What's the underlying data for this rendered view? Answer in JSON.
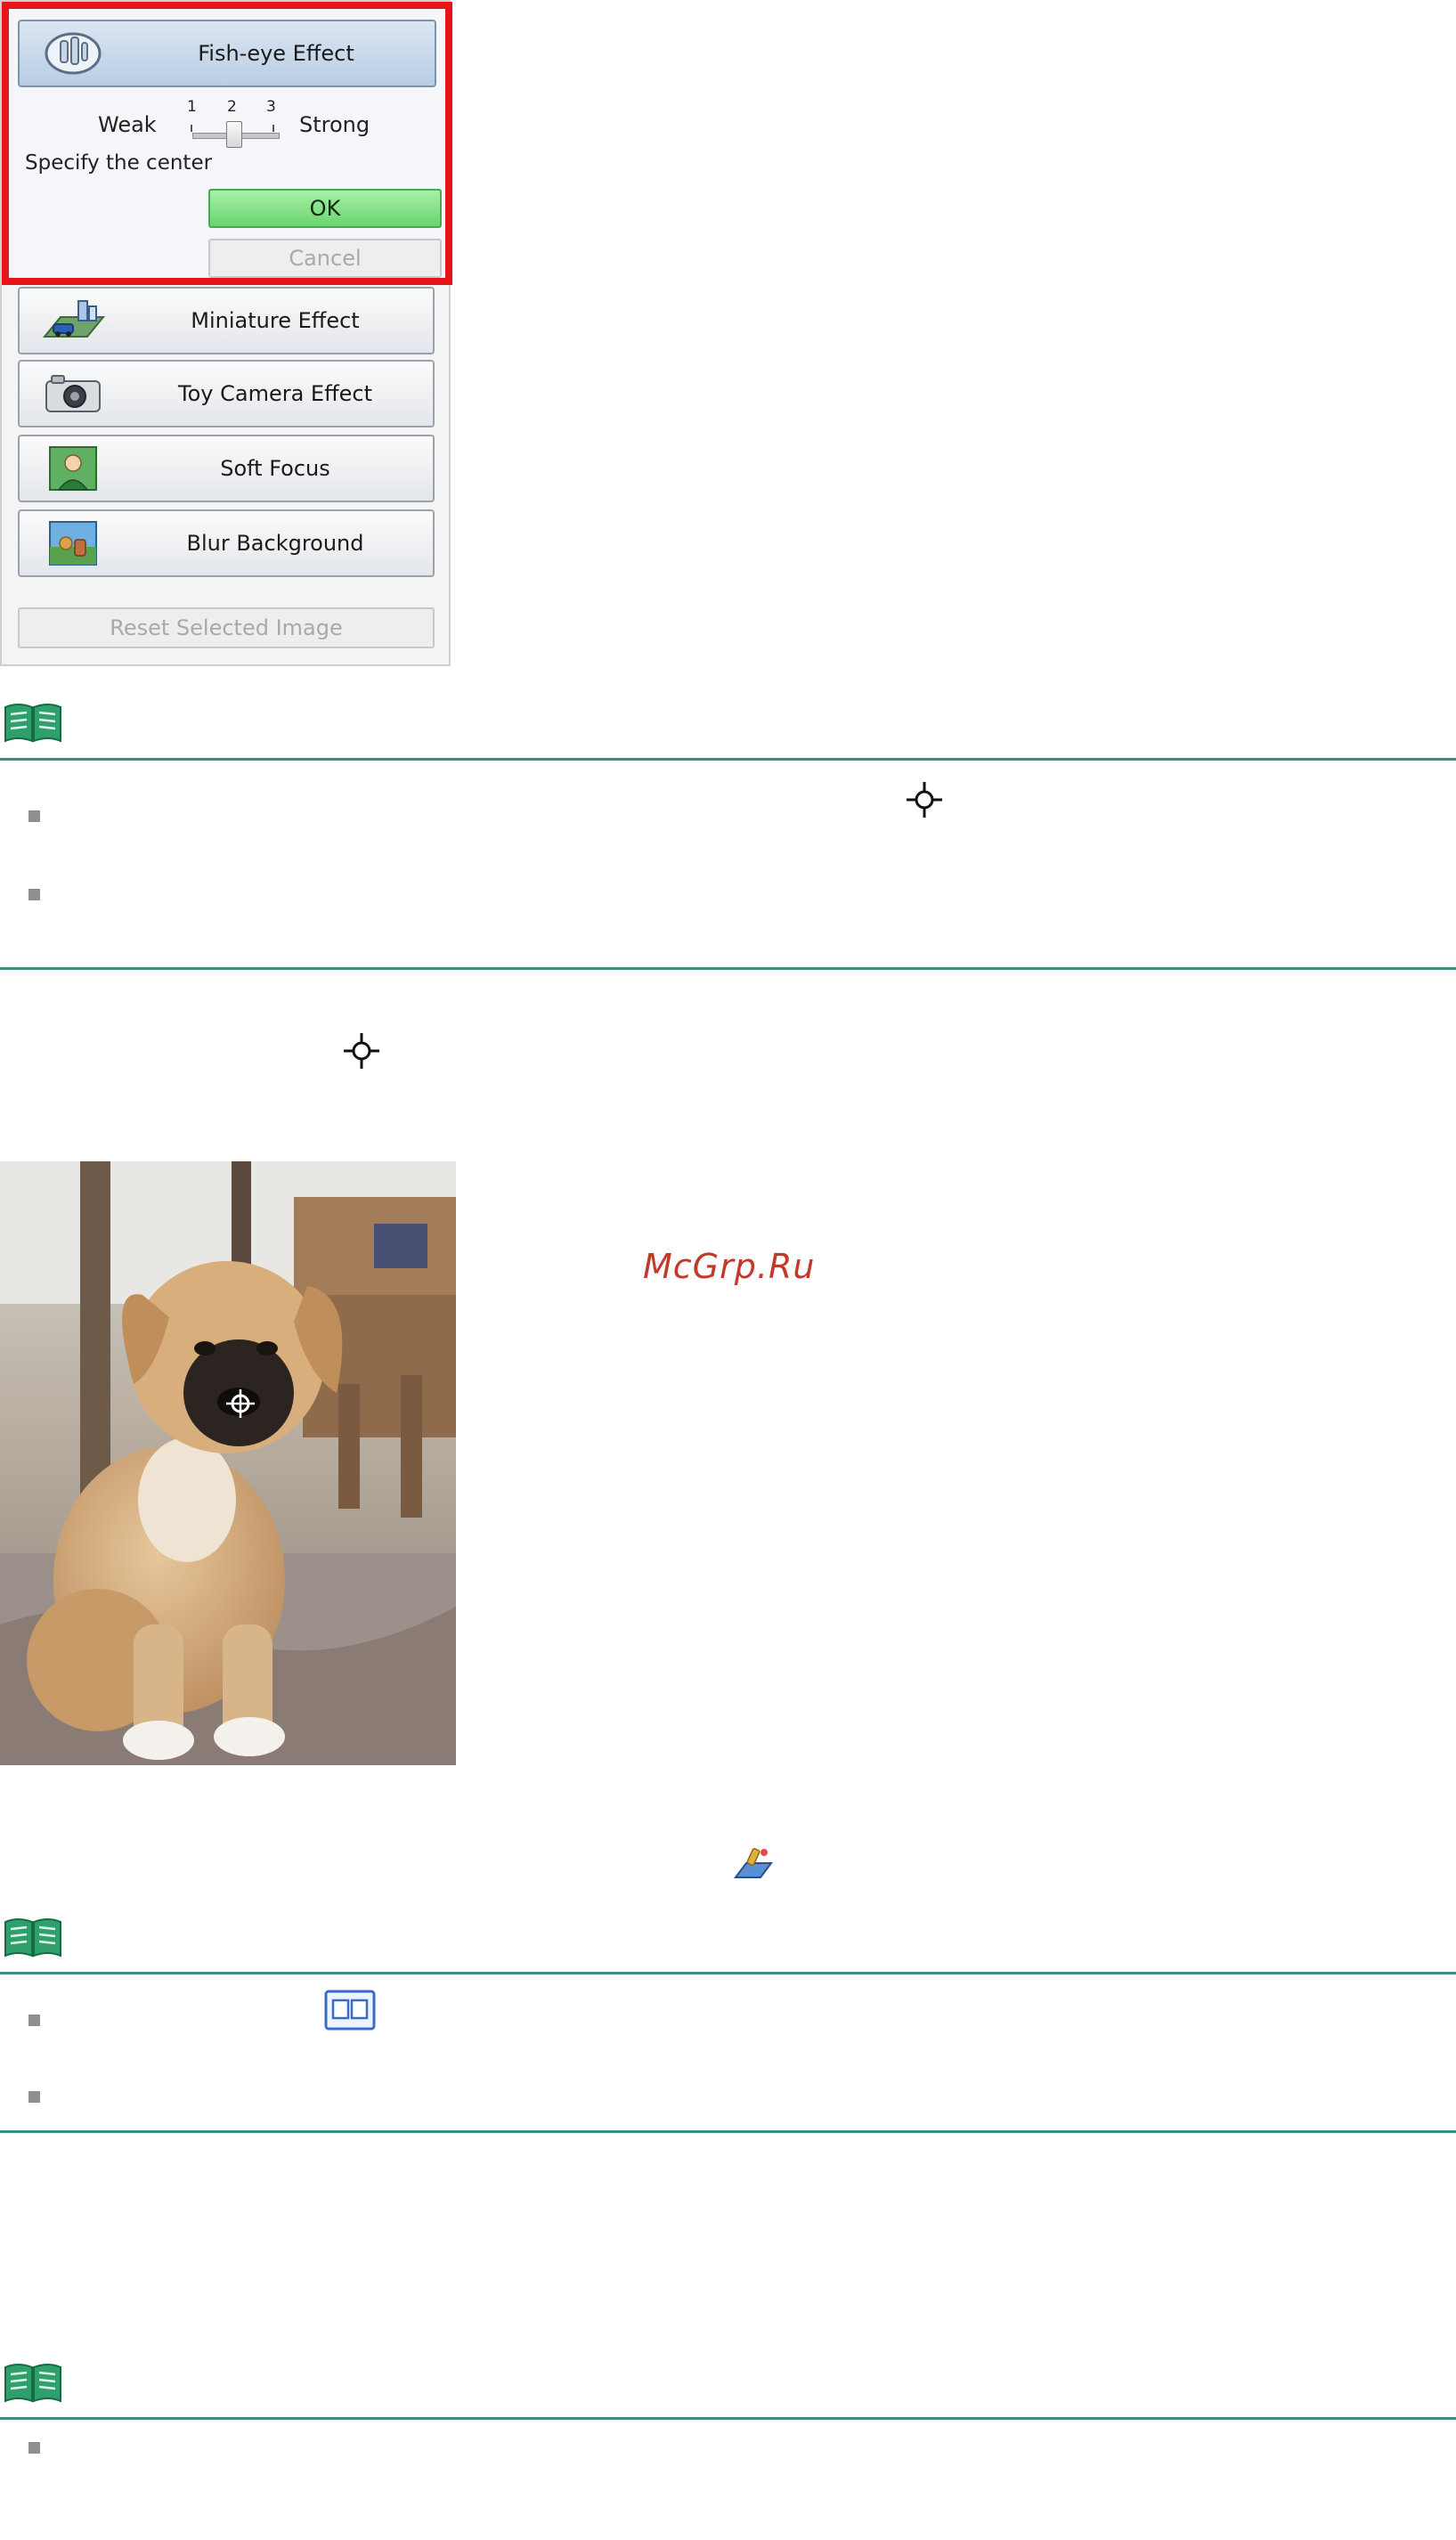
{
  "panel": {
    "fisheye_label": "Fish-eye Effect",
    "slider": {
      "weak_label": "Weak",
      "strong_label": "Strong",
      "ticks": [
        "1",
        "2",
        "3"
      ],
      "value": 2
    },
    "specify_center_label": "Specify the center",
    "ok_label": "OK",
    "cancel_label": "Cancel",
    "effects": [
      {
        "label": "Miniature Effect",
        "icon": "miniature-icon"
      },
      {
        "label": "Toy Camera Effect",
        "icon": "camera-icon"
      },
      {
        "label": "Soft Focus",
        "icon": "soft-focus-icon"
      },
      {
        "label": "Blur Background",
        "icon": "blur-background-icon"
      }
    ],
    "reset_label": "Reset Selected Image",
    "highlight_color": "#e8141b",
    "ok_color": "#6ad46e"
  },
  "watermark": "McGrp.Ru",
  "rule_color": "#3d8a84"
}
